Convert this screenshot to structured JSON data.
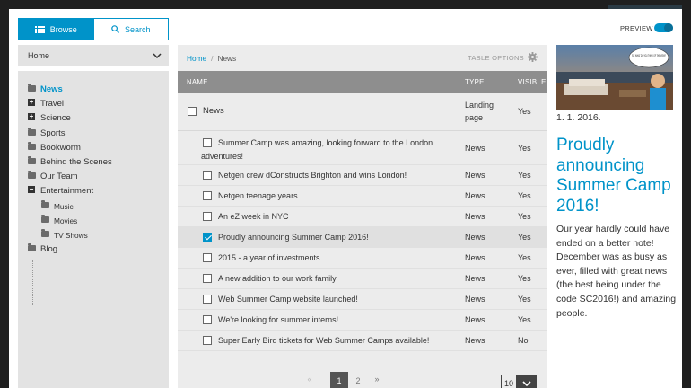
{
  "tabs": {
    "browse": "Browse",
    "search": "Search"
  },
  "location_select": {
    "value": "Home"
  },
  "tree": [
    {
      "label": "News",
      "icon": "folder-icon",
      "selected": true
    },
    {
      "label": "Travel",
      "icon": "expand-plus-icon"
    },
    {
      "label": "Science",
      "icon": "expand-plus-icon"
    },
    {
      "label": "Sports",
      "icon": "folder-icon"
    },
    {
      "label": "Bookworm",
      "icon": "folder-icon"
    },
    {
      "label": "Behind the Scenes",
      "icon": "folder-icon"
    },
    {
      "label": "Our Team",
      "icon": "folder-icon"
    },
    {
      "label": "Entertainment",
      "icon": "collapse-minus-icon"
    },
    {
      "label": "Music",
      "icon": "folder-icon",
      "child": true
    },
    {
      "label": "Movies",
      "icon": "folder-icon",
      "child": true
    },
    {
      "label": "TV Shows",
      "icon": "folder-icon",
      "child": true
    },
    {
      "label": "Blog",
      "icon": "folder-icon"
    }
  ],
  "breadcrumb": {
    "home": "Home",
    "separator": "/",
    "current": "News"
  },
  "table_options": "TABLE OPTIONS",
  "table": {
    "headers": {
      "name": "NAME",
      "type": "TYPE",
      "visible": "VISIBLE"
    },
    "parent_row": {
      "name": "News",
      "type_line1": "Landing",
      "type_line2": "page",
      "visible": "Yes"
    },
    "rows": [
      {
        "name_line1": "Summer Camp was amazing, looking forward to the London",
        "name_line2": "adventures!",
        "type": "News",
        "visible": "Yes",
        "checked": false
      },
      {
        "name": "Netgen crew dConstructs Brighton and wins London!",
        "type": "News",
        "visible": "Yes",
        "checked": false
      },
      {
        "name": "Netgen teenage years",
        "type": "News",
        "visible": "Yes",
        "checked": false
      },
      {
        "name": "An eZ week in NYC",
        "type": "News",
        "visible": "Yes",
        "checked": false
      },
      {
        "name": "Proudly announcing Summer Camp 2016!",
        "type": "News",
        "visible": "Yes",
        "checked": true
      },
      {
        "name": "2015 - a year of investments",
        "type": "News",
        "visible": "Yes",
        "checked": false
      },
      {
        "name": "A new addition to our work family",
        "type": "News",
        "visible": "Yes",
        "checked": false
      },
      {
        "name": "Web Summer Camp website launched!",
        "type": "News",
        "visible": "Yes",
        "checked": false
      },
      {
        "name": "We're looking for summer interns!",
        "type": "News",
        "visible": "Yes",
        "checked": false
      },
      {
        "name": "Super Early Bird tickets for Web Summer Camps available!",
        "type": "News",
        "visible": "No",
        "checked": false
      }
    ]
  },
  "pagination": {
    "prev": "«",
    "pages": [
      "1",
      "2"
    ],
    "current": "1",
    "next": "»",
    "per_page": "10"
  },
  "preview": {
    "label": "PREVIEW",
    "enabled": true,
    "speech_bubble": "SO, WHAT DO YOU THINK OF THE VIEW?",
    "date": "1. 1. 2016.",
    "title": "Proudly announcing Summer Camp 2016!",
    "body": "Our year hardly could have ended on a better note! December was as busy as ever, filled with great news (the best being under the code SC2016!) and amazing people."
  },
  "colors": {
    "accent": "#0093c9",
    "header": "#8e8e8e",
    "panel": "#e3e3e3",
    "table_bg": "#ececec"
  }
}
